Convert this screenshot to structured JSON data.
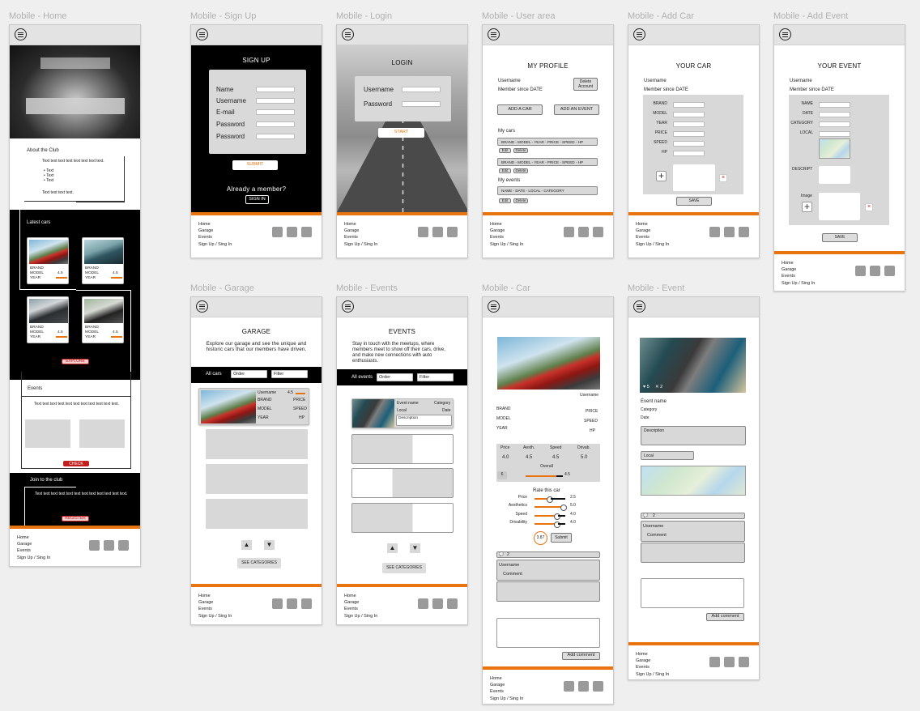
{
  "frames": {
    "home": {
      "label": "Mobile - Home",
      "about_title": "About the Club",
      "about_text": "Text text text text text text text text.",
      "about_bullets": [
        "Text",
        "Text",
        "Text"
      ],
      "about_text2": "Text text text text.",
      "latest_title": "Latest cars",
      "car_lines": [
        "BRAND",
        "MODEL",
        "YEAR"
      ],
      "rating": "4.5",
      "explore": "EXPLORE",
      "events_title": "Events",
      "events_text": "Text text text text text text text text text text text.",
      "check": "CHECK",
      "join_title": "Join to the club",
      "join_text": "Text text text text text text text text text text text text.",
      "register": "REGISTER"
    },
    "signup": {
      "label": "Mobile - Sign Up",
      "title": "SIGN UP",
      "fields": [
        "Name",
        "Username",
        "E-mail",
        "Password",
        "Password"
      ],
      "submit": "SUBMIT",
      "already": "Already a member?",
      "signin": "SIGN IN"
    },
    "login": {
      "label": "Mobile - Login",
      "title": "LOGIN",
      "fields": [
        "Username",
        "Password"
      ],
      "start": "START"
    },
    "user": {
      "label": "Mobile - User area",
      "title": "MY PROFILE",
      "username": "Username",
      "member_since": "Member since DATE",
      "delete_account": "Delete Account",
      "add_car": "ADD A CAR",
      "add_event": "ADD AN EVENT",
      "my_cars": "My cars",
      "car_row": "BRAND - MODEL - YEAR - PRICE - SPEED - HP",
      "edit": "Edit",
      "delete": "Delete",
      "my_events": "My events",
      "event_row": "NAME - DATE - LOCAL - CATEGORY"
    },
    "addcar": {
      "label": "Mobile - Add Car",
      "title": "YOUR CAR",
      "username": "Username",
      "member_since": "Member since DATE",
      "fields": [
        "BRAND",
        "MODEL",
        "YEAR",
        "PRICE",
        "SPEED",
        "HP"
      ],
      "save": "SAVE"
    },
    "addevent": {
      "label": "Mobile - Add Event",
      "title": "YOUR EVENT",
      "username": "Username",
      "member_since": "Member since DATE",
      "fields": [
        "NAME",
        "DATE",
        "CATEGORY",
        "LOCAL"
      ],
      "descript": "DESCRIPT",
      "image": "Image",
      "save": "SAVE"
    },
    "garage": {
      "label": "Mobile - Garage",
      "title": "GARAGE",
      "intro": [
        "Explore our garage and see the unique and",
        "historic cars that our members have driven."
      ],
      "all": "All cars",
      "order": "Order",
      "filter": "Filter",
      "card_user": "Username",
      "card_rating": "4.5",
      "card_left": [
        "BRAND",
        "MODEL",
        "YEAR"
      ],
      "card_right": [
        "PRICE",
        "SPEED",
        "HP"
      ],
      "see": "SEE CATEGORIES"
    },
    "events": {
      "label": "Mobile - Events",
      "title": "EVENTS",
      "intro": [
        "Stay in touch with the meetups, where",
        "members meet to show off their cars, drive,",
        "and make new connections with auto",
        "enthusiasts."
      ],
      "all": "All events",
      "order": "Order",
      "filter": "Filter",
      "ev_name": "Event name",
      "ev_category": "Category",
      "ev_local": "Local",
      "ev_date": "Date",
      "ev_desc": "Description",
      "see": "SEE CATEGORIES"
    },
    "car": {
      "label": "Mobile - Car",
      "username": "Username",
      "left": [
        "BRAND",
        "MODEL",
        "YEAR"
      ],
      "right": [
        "PRICE",
        "SPEED",
        "HP"
      ],
      "stats_heads": [
        "Price",
        "Aesth.",
        "Speed",
        "Drivab."
      ],
      "stats_vals": [
        "4.0",
        "4.5",
        "4.5",
        "5.0"
      ],
      "overall": "Overall",
      "overall_val": "4.5",
      "votes": "6",
      "rate_title": "Rate this car",
      "rate_labels": [
        "Price",
        "Aesthetics",
        "Speed",
        "Drivability"
      ],
      "rate_vals": [
        "2.5",
        "5.0",
        "4.0",
        "4.0"
      ],
      "rate_avg": "3.87",
      "submit": "Submit",
      "comments_count": "2",
      "c_user": "Username",
      "c_text": "Comment",
      "add_comment": "Add comment"
    },
    "event": {
      "label": "Mobile - Event",
      "likes": "5",
      "shares": "2",
      "name": "Event name",
      "category": "Category",
      "date": "Date",
      "desc": "Description",
      "local": "Local",
      "comments_count": "2",
      "c_user": "Username",
      "c_text": "Comment",
      "add_comment": "Add comment"
    }
  },
  "footer": {
    "links": [
      "Home",
      "Garage",
      "Events",
      "Sign Up / Sing In"
    ]
  },
  "colors": {
    "accent": "#e87410",
    "danger": "#c31d1d"
  }
}
